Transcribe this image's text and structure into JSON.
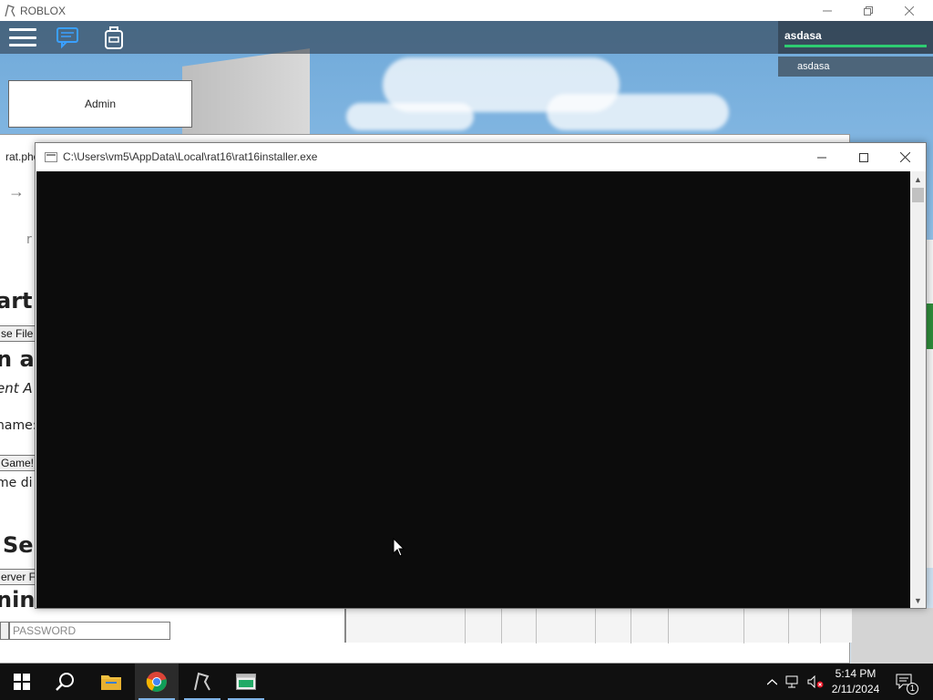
{
  "roblox": {
    "window_title": "ROBLOX",
    "player_name": "asdasa",
    "player_list": [
      "asdasa"
    ],
    "admin_button": "Admin",
    "health_fraction": 1.0
  },
  "browser": {
    "tab_title": "rat.pho",
    "fragments": {
      "tab2": "r",
      "heading1": "art",
      "choose_file": "se File",
      "heading2": "n a",
      "line_italic": "ent A",
      "line_name": "name:",
      "game_btn": "Game!",
      "line_me": "me di",
      "heading3": "Ser",
      "server_btn": "erver F",
      "heading4": "nin"
    },
    "password_placeholder": "PASSWORD"
  },
  "console": {
    "title": "C:\\Users\\vm5\\AppData\\Local\\rat16\\rat16installer.exe"
  },
  "taskbar": {
    "time": "5:14 PM",
    "date": "2/11/2024",
    "notification_count": "1"
  }
}
